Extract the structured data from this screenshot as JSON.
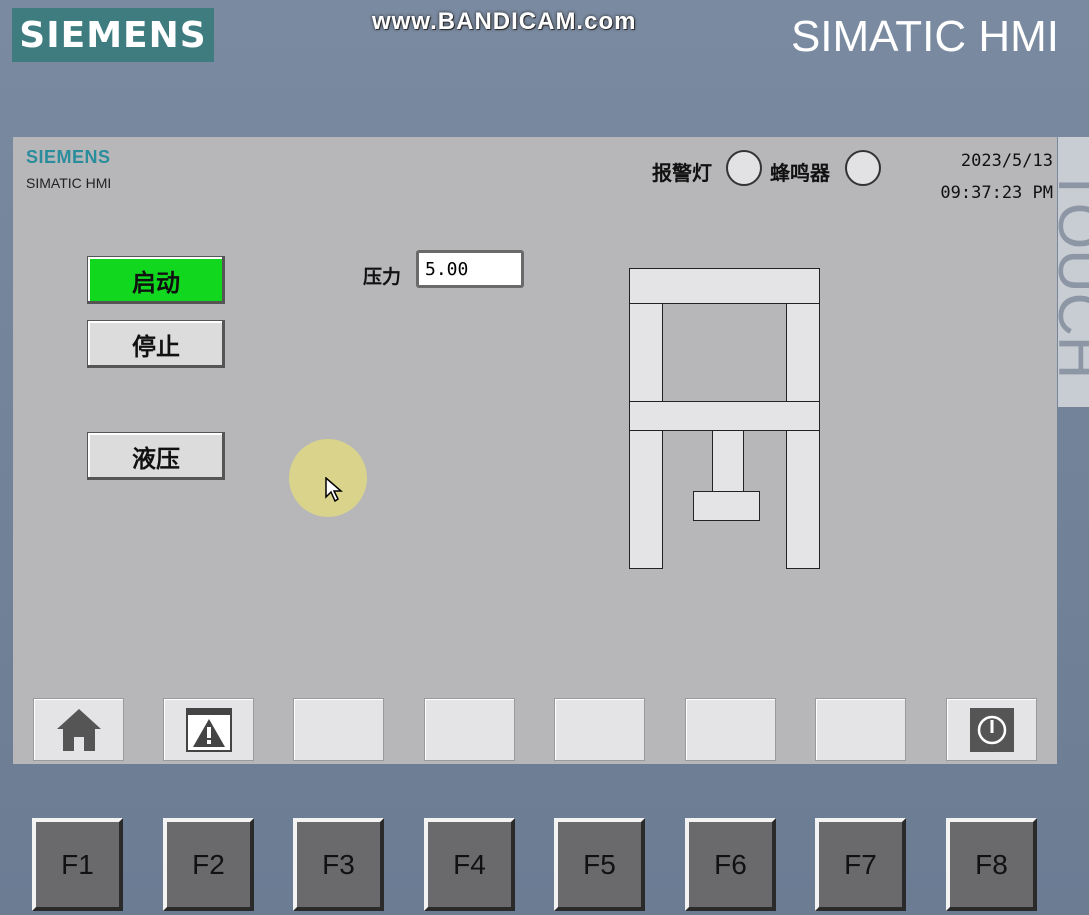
{
  "bezel": {
    "brand": "SIEMENS",
    "watermark": "www.BANDICAM.com",
    "product": "SIMATIC HMI",
    "side_text": "TOUCH"
  },
  "screen": {
    "logo": "SIEMENS",
    "subtitle": "SIMATIC HMI",
    "alarm_lamp_label": "报警灯",
    "buzzer_label": "蜂鸣器",
    "date": "2023/5/13",
    "time": "09:37:23 PM",
    "start_label": "启动",
    "stop_label": "停止",
    "hydraulic_label": "液压",
    "pressure_label": "压力",
    "pressure_value": "5.00",
    "start_active": true
  },
  "softkeys": [
    {
      "icon": "home-icon"
    },
    {
      "icon": "alarm-warning-icon"
    },
    {
      "icon": ""
    },
    {
      "icon": ""
    },
    {
      "icon": ""
    },
    {
      "icon": ""
    },
    {
      "icon": ""
    },
    {
      "icon": "power-icon"
    }
  ],
  "fkeys": [
    "F1",
    "F2",
    "F3",
    "F4",
    "F5",
    "F6",
    "F7",
    "F8"
  ],
  "colors": {
    "active_button": "#11d81e",
    "screen_bg": "#b7b6b9",
    "brand_teal": "#3e7c80"
  }
}
